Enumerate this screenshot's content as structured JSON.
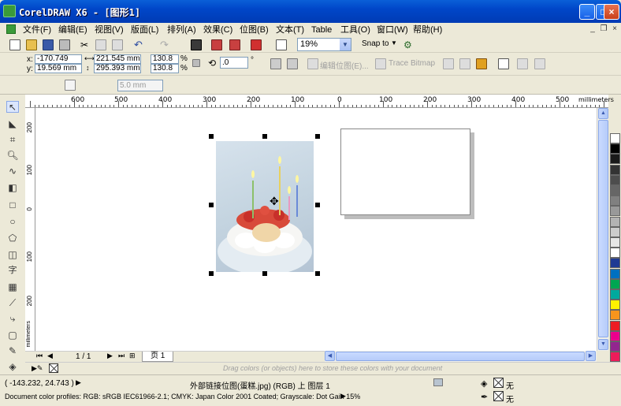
{
  "window": {
    "title": "CorelDRAW X6 - [图形1]",
    "minimize": "_",
    "maximize": "□",
    "close": "×"
  },
  "menu": [
    {
      "label": "文件(F)"
    },
    {
      "label": "编辑(E)"
    },
    {
      "label": "视图(V)"
    },
    {
      "label": "版面(L)"
    },
    {
      "label": "排列(A)"
    },
    {
      "label": "效果(C)"
    },
    {
      "label": "位图(B)"
    },
    {
      "label": "文本(T)"
    },
    {
      "label": "Table"
    },
    {
      "label": "工具(O)"
    },
    {
      "label": "窗口(W)"
    },
    {
      "label": "帮助(H)"
    }
  ],
  "doc_controls": {
    "minimize": "_",
    "restore": "❐",
    "close": "×"
  },
  "toolbar": {
    "zoom": "19%",
    "snap_to": "Snap to"
  },
  "properties": {
    "x_label": "x:",
    "x_value": "-170.749 mm",
    "y_label": "y:",
    "y_value": "19.569 mm",
    "w_value": "221.545 mm",
    "h_value": "295.393 mm",
    "scale_x": "130.8",
    "scale_y": "130.8",
    "pct": "%",
    "angle": ".0",
    "degree": "°",
    "edit_bitmap": "编辑位图(E)...",
    "trace_bitmap": "Trace Bitmap"
  },
  "subbar": {
    "outline_width": "5.0 mm"
  },
  "ruler": {
    "h_labels": [
      "600",
      "500",
      "400",
      "300",
      "200",
      "100",
      "0",
      "100",
      "200",
      "300",
      "400",
      "500"
    ],
    "unit": "millimeters",
    "v_labels": [
      "200",
      "100",
      "0",
      "100",
      "200"
    ],
    "v_unit": "millimeters"
  },
  "pages": {
    "counter": "1 / 1",
    "tab": "页 1"
  },
  "color_well_hint": "Drag colors (or objects) here to store these colors with your document",
  "palette": [
    "#ffffff",
    "#000000",
    "#1a1a1a",
    "#333333",
    "#4d4d4d",
    "#666666",
    "#808080",
    "#999999",
    "#b3b3b3",
    "#cccccc",
    "#e6e6e6",
    "#ffffff",
    "#1f3a93",
    "#0070c0",
    "#00a651",
    "#00a99d",
    "#fff200",
    "#f7941d",
    "#ed1c24",
    "#ec008c",
    "#92278f",
    "#ed1c5a",
    "#f26522"
  ],
  "status": {
    "coords": "( -143.232, 24.743 )",
    "object_info": "外部链接位图(蛋糕.jpg) (RGB) 上 图层 1",
    "fill_label": "无",
    "outline_label": "无",
    "color_profiles": "Document color profiles: RGB: sRGB IEC61966-2.1; CMYK: Japan Color 2001 Coated; Grayscale: Dot Gain 15%"
  }
}
